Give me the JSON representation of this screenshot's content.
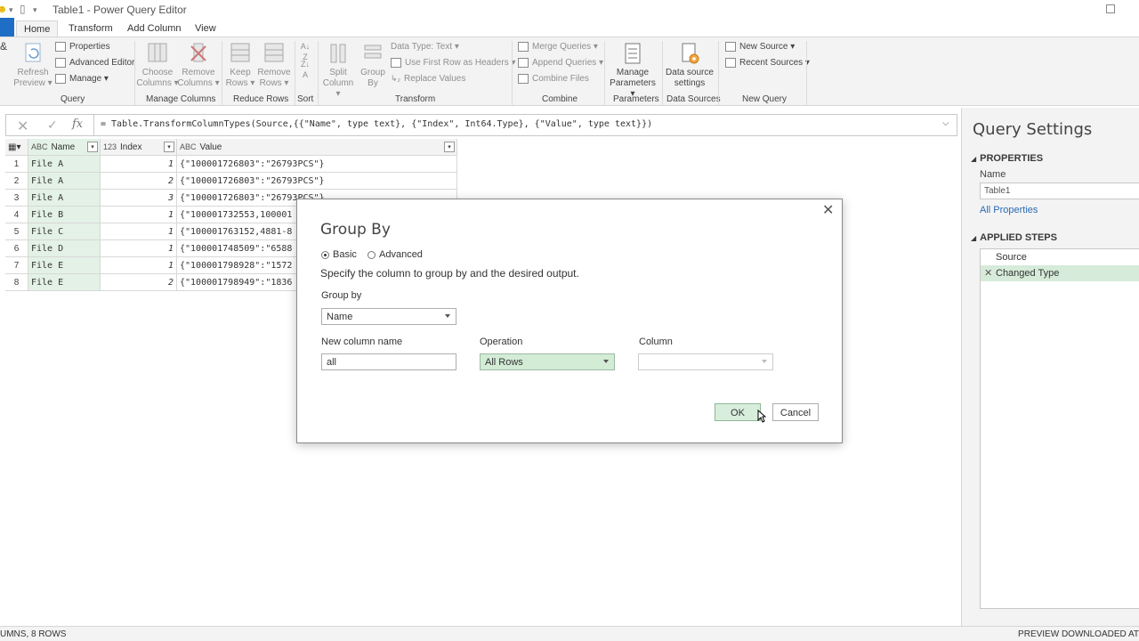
{
  "window": {
    "title": "Table1 - Power Query Editor"
  },
  "tabs": [
    "Home",
    "Transform",
    "Add Column",
    "View"
  ],
  "ribbon": {
    "query": {
      "refresh": "Refresh",
      "refresh2": "Preview",
      "properties": "Properties",
      "advanced_editor": "Advanced Editor",
      "manage": "Manage",
      "group": "Query"
    },
    "manage_columns": {
      "choose": "Choose",
      "choose2": "Columns",
      "remove": "Remove",
      "remove2": "Columns",
      "group": "Manage Columns"
    },
    "reduce_rows": {
      "keep": "Keep",
      "keep2": "Rows",
      "remove": "Remove",
      "remove2": "Rows",
      "group": "Reduce Rows"
    },
    "sort": {
      "group": "Sort"
    },
    "transform": {
      "split": "Split",
      "split2": "Column",
      "groupby": "Group",
      "groupby2": "By",
      "data_type": "Data Type: Text",
      "first_row": "Use First Row as Headers",
      "replace": "Replace Values",
      "group": "Transform"
    },
    "combine": {
      "merge": "Merge Queries",
      "append": "Append Queries",
      "combine_files": "Combine Files",
      "group": "Combine"
    },
    "parameters": {
      "manage": "Manage",
      "manage2": "Parameters",
      "group": "Parameters"
    },
    "data_sources": {
      "settings": "Data source",
      "settings2": "settings",
      "group": "Data Sources"
    },
    "new_query": {
      "new_source": "New Source",
      "recent": "Recent Sources",
      "group": "New Query"
    }
  },
  "formula_bar": {
    "formula": "= Table.TransformColumnTypes(Source,{{\"Name\", type text}, {\"Index\", Int64.Type}, {\"Value\", type text}})"
  },
  "grid": {
    "columns": [
      {
        "type": "ABC",
        "name": "Name"
      },
      {
        "type": "123",
        "name": "Index"
      },
      {
        "type": "ABC",
        "name": "Value"
      }
    ],
    "rows": [
      {
        "num": "1",
        "name": "File A",
        "index": "1",
        "value": "{\"100001726803\":\"26793PCS\"}"
      },
      {
        "num": "2",
        "name": "File A",
        "index": "2",
        "value": "{\"100001726803\":\"26793PCS\"}"
      },
      {
        "num": "3",
        "name": "File A",
        "index": "3",
        "value": "{\"100001726803\":\"26793PCS\"}"
      },
      {
        "num": "4",
        "name": "File B",
        "index": "1",
        "value": "{\"100001732553,100001"
      },
      {
        "num": "5",
        "name": "File C",
        "index": "1",
        "value": "{\"100001763152,4881-8"
      },
      {
        "num": "6",
        "name": "File D",
        "index": "1",
        "value": "{\"100001748509\":\"6588"
      },
      {
        "num": "7",
        "name": "File E",
        "index": "1",
        "value": "{\"100001798928\":\"1572"
      },
      {
        "num": "8",
        "name": "File E",
        "index": "2",
        "value": "{\"100001798949\":\"1836"
      }
    ]
  },
  "query_settings": {
    "title": "Query Settings",
    "properties_header": "PROPERTIES",
    "name_label": "Name",
    "name_value": "Table1",
    "all_properties": "All Properties",
    "applied_steps_header": "APPLIED STEPS",
    "steps": [
      "Source",
      "Changed Type"
    ]
  },
  "status": {
    "left": "UMNS, 8 ROWS",
    "right": "PREVIEW DOWNLOADED AT"
  },
  "dialog": {
    "title": "Group By",
    "radio_basic": "Basic",
    "radio_advanced": "Advanced",
    "description": "Specify the column to group by and the desired output.",
    "group_by_label": "Group by",
    "group_by_value": "Name",
    "new_col_label": "New column name",
    "new_col_value": "all",
    "operation_label": "Operation",
    "operation_value": "All Rows",
    "column_label": "Column",
    "column_value": "",
    "ok": "OK",
    "cancel": "Cancel"
  }
}
